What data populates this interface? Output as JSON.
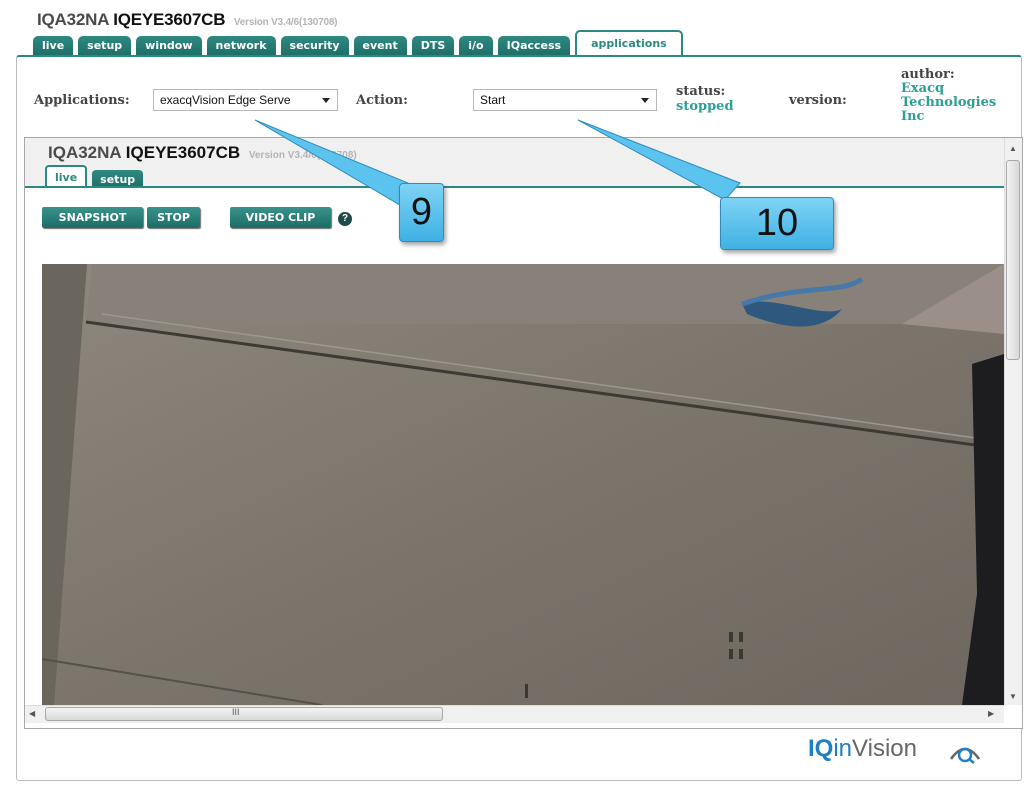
{
  "header": {
    "model": "IQA32NA",
    "device": "IQEYE3607CB",
    "version": "Version V3.4/6(130708)"
  },
  "tabs": [
    "live",
    "setup",
    "window",
    "network",
    "security",
    "event",
    "DTS",
    "i/o",
    "IQaccess",
    "applications"
  ],
  "active_tab": "applications",
  "applications_bar": {
    "applications_label": "Applications:",
    "applications_value": "exacqVision Edge Serve",
    "action_label": "Action:",
    "action_value": "Start",
    "status_label": "status:",
    "status_value": "stopped",
    "version_label": "version:",
    "author_label": "author:",
    "author_value": "Exacq Technologies Inc"
  },
  "inner_page": {
    "model": "IQA32NA",
    "device": "IQEYE3607CB",
    "version": "Version V3.4/6(130708)",
    "tabs": [
      "live",
      "setup"
    ],
    "active_tab": "live",
    "buttons": {
      "snapshot": "SNAPSHOT",
      "stop": "STOP",
      "video_clip": "VIDEO CLIP",
      "help": "?"
    },
    "scroll_grip": "III"
  },
  "footer": {
    "logo_bold": "IQ",
    "logo_mid": "in",
    "logo_rest": "Vision"
  },
  "callouts": [
    "9",
    "10"
  ],
  "colors": {
    "accent": "#2a8a82",
    "status": "#2aa096",
    "callout": "#5cc3ee"
  }
}
